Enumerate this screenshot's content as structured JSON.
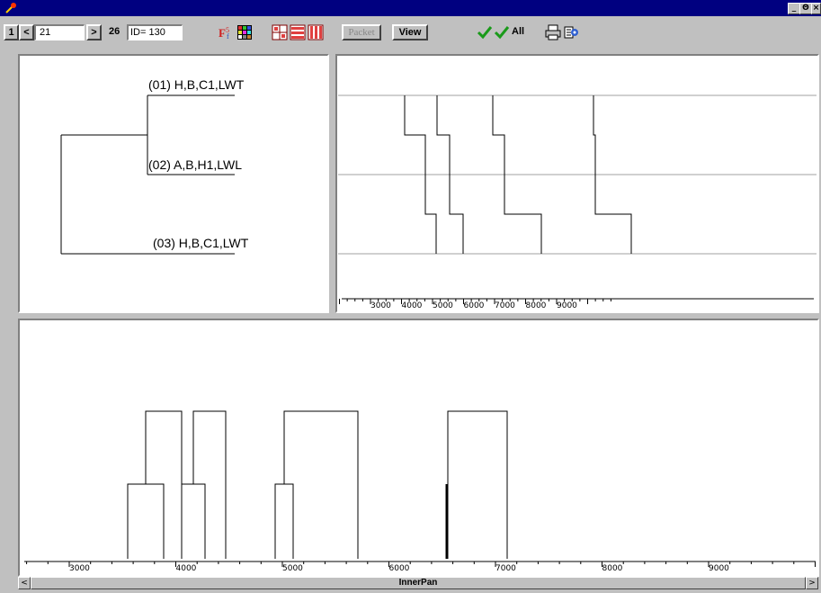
{
  "window": {
    "controls": {
      "minimize": "_",
      "restore": "Θ",
      "close": "×"
    }
  },
  "toolbar": {
    "first_label": "1",
    "prev_label": "<",
    "current_value": "21",
    "next_label": ">",
    "total_label": "26",
    "id_value": "ID= 130",
    "packet_label": "Packet",
    "view_label": "View",
    "all_label": "All",
    "icons": [
      "font-icon",
      "color-grid-icon",
      "layout-grid-icon",
      "layout-rows-icon",
      "layout-columns-icon",
      "check-icon",
      "check-all-icon",
      "print-icon",
      "settings-icon"
    ]
  },
  "tree": {
    "leaves": [
      "(01) H,B,C1,LWT",
      "(02) A,B,H1,LWL",
      "(03) H,B,C1,LWT"
    ]
  },
  "top_axis": {
    "ticks": [
      "3000",
      "4000",
      "5000",
      "6000",
      "7000",
      "8000",
      "9000"
    ]
  },
  "bottom_axis": {
    "ticks": [
      "3000",
      "4000",
      "5000",
      "6000",
      "7000",
      "8000",
      "9000"
    ]
  },
  "scrollbar": {
    "label": "InnerPan",
    "left_arrow": "<",
    "right_arrow": ">"
  },
  "colors": {
    "title_bar": "#000080",
    "face": "#c0c0c0",
    "check_green": "#1a9a1a"
  }
}
